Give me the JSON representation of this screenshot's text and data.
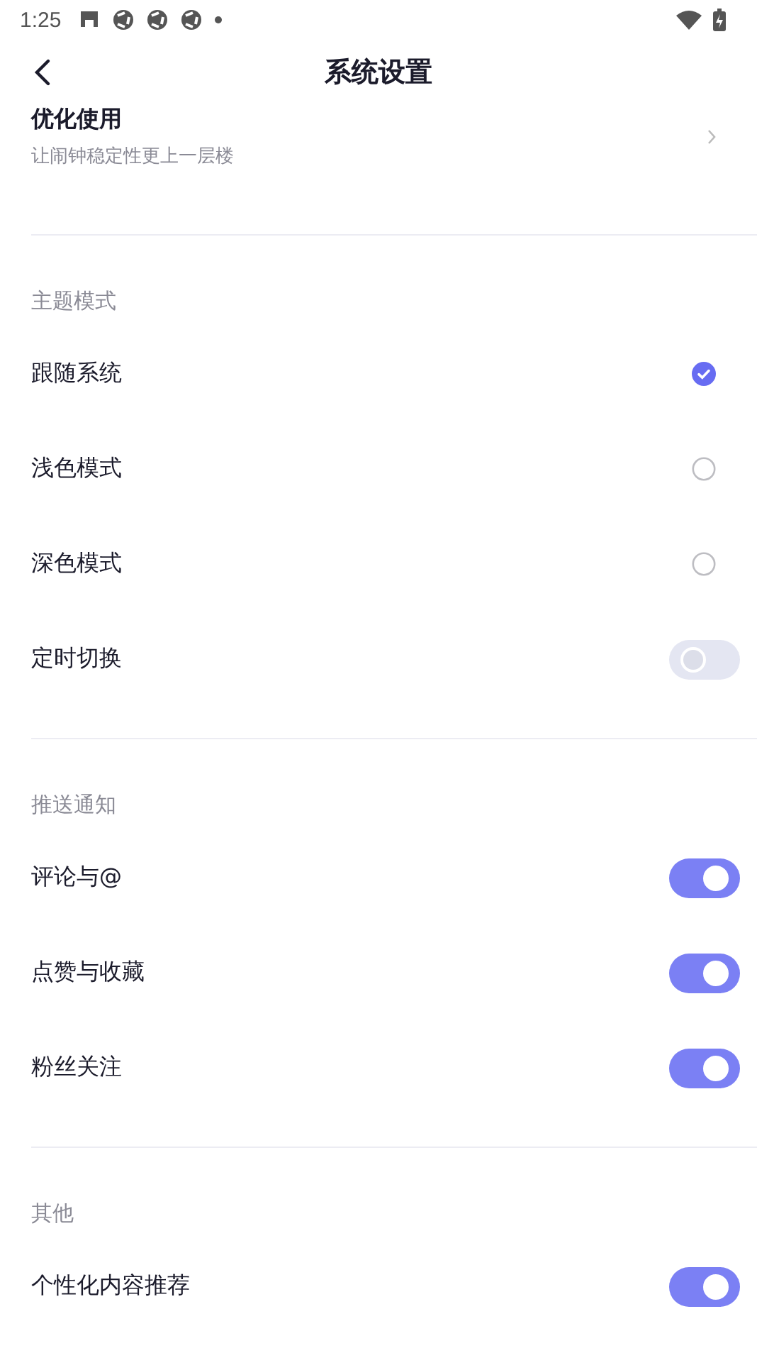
{
  "status_bar": {
    "time": "1:25"
  },
  "header": {
    "title": "系统设置"
  },
  "sections": [
    {
      "items": [
        {
          "kind": "link",
          "label": "优化使用",
          "subtitle": "让闹钟稳定性更上一层楼"
        }
      ]
    },
    {
      "title": "主题模式",
      "items": [
        {
          "kind": "radio",
          "label": "跟随系统",
          "selected": true
        },
        {
          "kind": "radio",
          "label": "浅色模式",
          "selected": false
        },
        {
          "kind": "radio",
          "label": "深色模式",
          "selected": false
        },
        {
          "kind": "toggle",
          "label": "定时切换",
          "on": false
        }
      ]
    },
    {
      "title": "推送通知",
      "items": [
        {
          "kind": "toggle",
          "label": "评论与@",
          "on": true
        },
        {
          "kind": "toggle",
          "label": "点赞与收藏",
          "on": true
        },
        {
          "kind": "toggle",
          "label": "粉丝关注",
          "on": true
        }
      ]
    },
    {
      "title": "其他",
      "items": [
        {
          "kind": "toggle",
          "label": "个性化内容推荐",
          "on": true
        }
      ]
    }
  ]
}
